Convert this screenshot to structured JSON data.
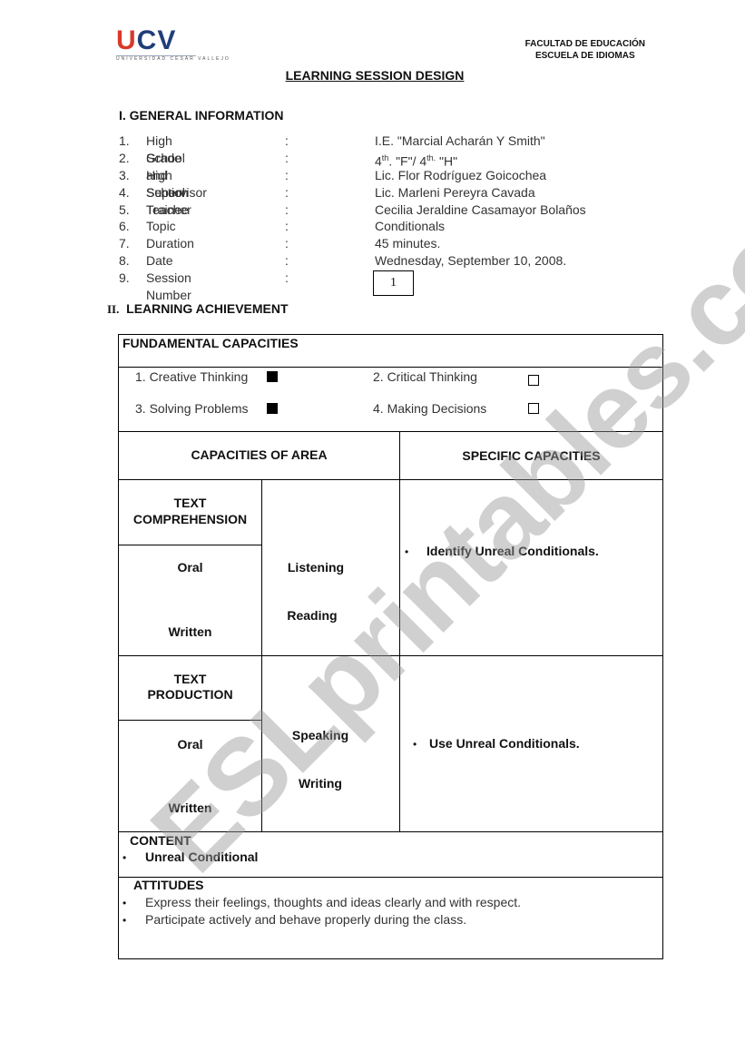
{
  "header": {
    "logo": {
      "text_u": "U",
      "text_cv": "CV",
      "subtitle": "UNIVERSIDAD CÉSAR VALLEJO"
    },
    "faculty_line1": "FACULTAD DE EDUCACIÓN",
    "faculty_line2": "ESCUELA DE IDIOMAS",
    "title": "LEARNING SESSION DESIGN"
  },
  "general_information": {
    "heading": "I. GENERAL INFORMATION",
    "items": [
      {
        "num": "1.",
        "label": "High School",
        "value": "I.E. \"Marcial Acharán Y Smith\""
      },
      {
        "num": "2.",
        "label": "Grade and Section",
        "value_parts": [
          "4",
          "th",
          ". \"F\"/  4",
          "th.",
          " \"H\""
        ]
      },
      {
        "num": "3.",
        "label": "High School Teacher",
        "value": "Lic. Flor Rodríguez Goicochea"
      },
      {
        "num": "4.",
        "label": "Supervisor",
        "value": "Lic. Marleni Pereyra Cavada"
      },
      {
        "num": "5.",
        "label": "Trainee",
        "value": "Cecilia Jeraldine Casamayor Bolaños"
      },
      {
        "num": "6.",
        "label": "Topic",
        "value": "Conditionals"
      },
      {
        "num": "7.",
        "label": "Duration",
        "value": "45 minutes."
      },
      {
        "num": "8.",
        "label": "Date",
        "value": "Wednesday, September 10, 2008."
      },
      {
        "num": "9.",
        "label": "Session Number",
        "value": "1"
      }
    ],
    "colon": ":"
  },
  "learning_achievement": {
    "heading_roman": "II.",
    "heading": "LEARNING ACHIEVEMENT",
    "fundamental_capacities": {
      "heading": "FUNDAMENTAL CAPACITIES",
      "items": [
        {
          "label": "1. Creative Thinking",
          "checked": true
        },
        {
          "label": "2. Critical Thinking",
          "checked": false
        },
        {
          "label": "3. Solving Problems",
          "checked": true
        },
        {
          "label": "4. Making Decisions",
          "checked": false
        }
      ]
    },
    "capacities_of_area_header": "CAPACITIES OF AREA",
    "specific_capacities_header": "SPECIFIC CAPACITIES",
    "comprehension": {
      "area_line1": "TEXT",
      "area_line2": "COMPREHENSION",
      "oral": "Oral",
      "written": "Written",
      "skill1": "Listening",
      "skill2": "Reading",
      "specific": "Identify Unreal Conditionals."
    },
    "production": {
      "area_line1": "TEXT",
      "area_line2": "PRODUCTION",
      "oral": "Oral",
      "written": "Written",
      "skill1": "Speaking",
      "skill2": "Writing",
      "specific": "Use Unreal Conditionals."
    },
    "content": {
      "heading": "CONTENT",
      "items": [
        "Unreal Conditional"
      ]
    },
    "attitudes": {
      "heading": "ATTITUDES",
      "items": [
        "Express their feelings, thoughts and ideas clearly and with respect.",
        "Participate actively and behave properly during the class."
      ]
    }
  },
  "watermark": "ESLprintables.com",
  "bullet_glyph": "•"
}
